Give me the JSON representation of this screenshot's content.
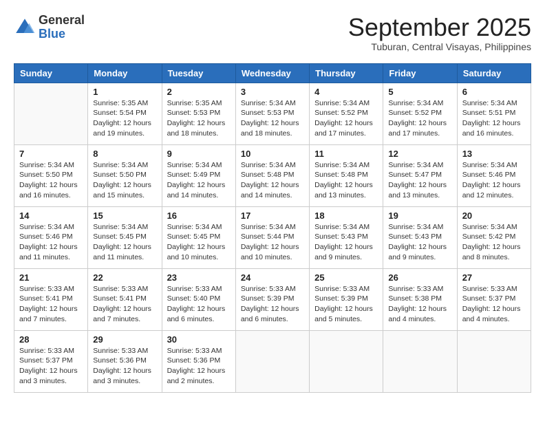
{
  "header": {
    "logo_general": "General",
    "logo_blue": "Blue",
    "month_title": "September 2025",
    "location": "Tuburan, Central Visayas, Philippines"
  },
  "columns": [
    "Sunday",
    "Monday",
    "Tuesday",
    "Wednesday",
    "Thursday",
    "Friday",
    "Saturday"
  ],
  "weeks": [
    [
      {
        "day": "",
        "info": ""
      },
      {
        "day": "1",
        "info": "Sunrise: 5:35 AM\nSunset: 5:54 PM\nDaylight: 12 hours\nand 19 minutes."
      },
      {
        "day": "2",
        "info": "Sunrise: 5:35 AM\nSunset: 5:53 PM\nDaylight: 12 hours\nand 18 minutes."
      },
      {
        "day": "3",
        "info": "Sunrise: 5:34 AM\nSunset: 5:53 PM\nDaylight: 12 hours\nand 18 minutes."
      },
      {
        "day": "4",
        "info": "Sunrise: 5:34 AM\nSunset: 5:52 PM\nDaylight: 12 hours\nand 17 minutes."
      },
      {
        "day": "5",
        "info": "Sunrise: 5:34 AM\nSunset: 5:52 PM\nDaylight: 12 hours\nand 17 minutes."
      },
      {
        "day": "6",
        "info": "Sunrise: 5:34 AM\nSunset: 5:51 PM\nDaylight: 12 hours\nand 16 minutes."
      }
    ],
    [
      {
        "day": "7",
        "info": "Sunrise: 5:34 AM\nSunset: 5:50 PM\nDaylight: 12 hours\nand 16 minutes."
      },
      {
        "day": "8",
        "info": "Sunrise: 5:34 AM\nSunset: 5:50 PM\nDaylight: 12 hours\nand 15 minutes."
      },
      {
        "day": "9",
        "info": "Sunrise: 5:34 AM\nSunset: 5:49 PM\nDaylight: 12 hours\nand 14 minutes."
      },
      {
        "day": "10",
        "info": "Sunrise: 5:34 AM\nSunset: 5:48 PM\nDaylight: 12 hours\nand 14 minutes."
      },
      {
        "day": "11",
        "info": "Sunrise: 5:34 AM\nSunset: 5:48 PM\nDaylight: 12 hours\nand 13 minutes."
      },
      {
        "day": "12",
        "info": "Sunrise: 5:34 AM\nSunset: 5:47 PM\nDaylight: 12 hours\nand 13 minutes."
      },
      {
        "day": "13",
        "info": "Sunrise: 5:34 AM\nSunset: 5:46 PM\nDaylight: 12 hours\nand 12 minutes."
      }
    ],
    [
      {
        "day": "14",
        "info": "Sunrise: 5:34 AM\nSunset: 5:46 PM\nDaylight: 12 hours\nand 11 minutes."
      },
      {
        "day": "15",
        "info": "Sunrise: 5:34 AM\nSunset: 5:45 PM\nDaylight: 12 hours\nand 11 minutes."
      },
      {
        "day": "16",
        "info": "Sunrise: 5:34 AM\nSunset: 5:45 PM\nDaylight: 12 hours\nand 10 minutes."
      },
      {
        "day": "17",
        "info": "Sunrise: 5:34 AM\nSunset: 5:44 PM\nDaylight: 12 hours\nand 10 minutes."
      },
      {
        "day": "18",
        "info": "Sunrise: 5:34 AM\nSunset: 5:43 PM\nDaylight: 12 hours\nand 9 minutes."
      },
      {
        "day": "19",
        "info": "Sunrise: 5:34 AM\nSunset: 5:43 PM\nDaylight: 12 hours\nand 9 minutes."
      },
      {
        "day": "20",
        "info": "Sunrise: 5:34 AM\nSunset: 5:42 PM\nDaylight: 12 hours\nand 8 minutes."
      }
    ],
    [
      {
        "day": "21",
        "info": "Sunrise: 5:33 AM\nSunset: 5:41 PM\nDaylight: 12 hours\nand 7 minutes."
      },
      {
        "day": "22",
        "info": "Sunrise: 5:33 AM\nSunset: 5:41 PM\nDaylight: 12 hours\nand 7 minutes."
      },
      {
        "day": "23",
        "info": "Sunrise: 5:33 AM\nSunset: 5:40 PM\nDaylight: 12 hours\nand 6 minutes."
      },
      {
        "day": "24",
        "info": "Sunrise: 5:33 AM\nSunset: 5:39 PM\nDaylight: 12 hours\nand 6 minutes."
      },
      {
        "day": "25",
        "info": "Sunrise: 5:33 AM\nSunset: 5:39 PM\nDaylight: 12 hours\nand 5 minutes."
      },
      {
        "day": "26",
        "info": "Sunrise: 5:33 AM\nSunset: 5:38 PM\nDaylight: 12 hours\nand 4 minutes."
      },
      {
        "day": "27",
        "info": "Sunrise: 5:33 AM\nSunset: 5:37 PM\nDaylight: 12 hours\nand 4 minutes."
      }
    ],
    [
      {
        "day": "28",
        "info": "Sunrise: 5:33 AM\nSunset: 5:37 PM\nDaylight: 12 hours\nand 3 minutes."
      },
      {
        "day": "29",
        "info": "Sunrise: 5:33 AM\nSunset: 5:36 PM\nDaylight: 12 hours\nand 3 minutes."
      },
      {
        "day": "30",
        "info": "Sunrise: 5:33 AM\nSunset: 5:36 PM\nDaylight: 12 hours\nand 2 minutes."
      },
      {
        "day": "",
        "info": ""
      },
      {
        "day": "",
        "info": ""
      },
      {
        "day": "",
        "info": ""
      },
      {
        "day": "",
        "info": ""
      }
    ]
  ]
}
